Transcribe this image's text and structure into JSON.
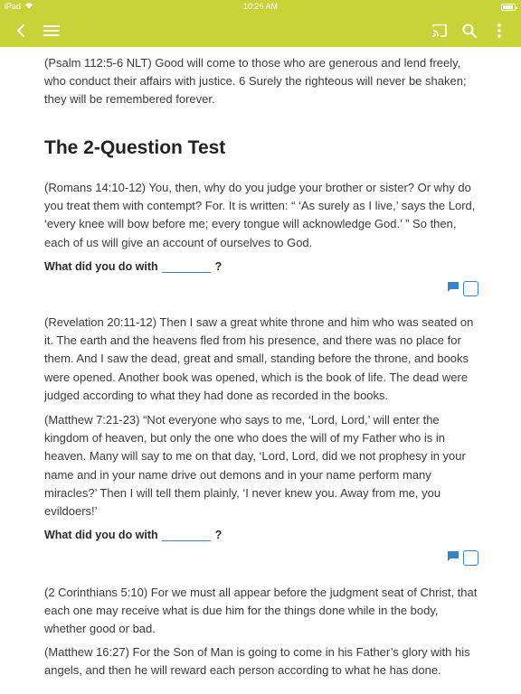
{
  "status_bar": {
    "device": "iPad",
    "time": "10:26 AM",
    "battery_level": 0.9
  },
  "toolbar": {
    "back_icon": "chevron-left-icon",
    "menu_icon": "hamburger-menu-icon",
    "cast_icon": "cast-icon",
    "search_icon": "search-icon",
    "more_icon": "more-vertical-icon"
  },
  "colors": {
    "accent": "#c8d33a",
    "link_blue": "#3b82c4",
    "text": "#333333"
  },
  "document": {
    "intro_paragraph": "(Psalm 112:5-6 NLT) Good will come to those who are generous and lend freely, who conduct their affairs with justice. 6 Surely the righteous will never be shaken; they will be remembered forever.",
    "section_heading": "The 2-Question Test",
    "block1": {
      "paragraph": "(Romans 14:10-12) You, then, why do you judge your brother or sister? Or why do you treat them with contempt? For. It is written: “ ‘As surely as I live,’ says the Lord, ‘every knee will bow before me; every tongue will acknowledge God.’ ” So then, each of us will give an account of ourselves to God.",
      "question_prefix": "What did you do with",
      "question_suffix": "?",
      "answer_value": ""
    },
    "block2": {
      "paragraph1": "(Revelation 20:11-12) Then I saw a great white throne and him who was seated on it. The earth and the heavens fled from his presence, and there was no place for them. And I saw the dead, great and small, standing before the throne, and books were opened. Another book was opened, which is the book of life. The dead were judged according to what they had done as recorded in the books.",
      "paragraph2": "(Matthew 7:21-23) “Not everyone who says to me, ‘Lord, Lord,’ will enter the kingdom of heaven, but only the one who does the will of my Father who is in heaven. Many will say to me on that day, ‘Lord, Lord, did we not prophesy in your name and in your name drive out demons and in your name perform many miracles?’ Then I will tell them plainly, ‘I never knew you. Away from me, you evildoers!’",
      "question_prefix": "What did you do with",
      "question_suffix": "?",
      "answer_value": ""
    },
    "block3": {
      "paragraph1": "(2 Corinthians 5:10) For we must all appear before the judgment seat of Christ, that each one may receive what is due him for the things done while in the body, whether good or bad.",
      "paragraph2": "(Matthew 16:27) For the Son of Man is going to come in his Father’s glory with his angels, and then he will reward each person according to what he has done."
    }
  }
}
